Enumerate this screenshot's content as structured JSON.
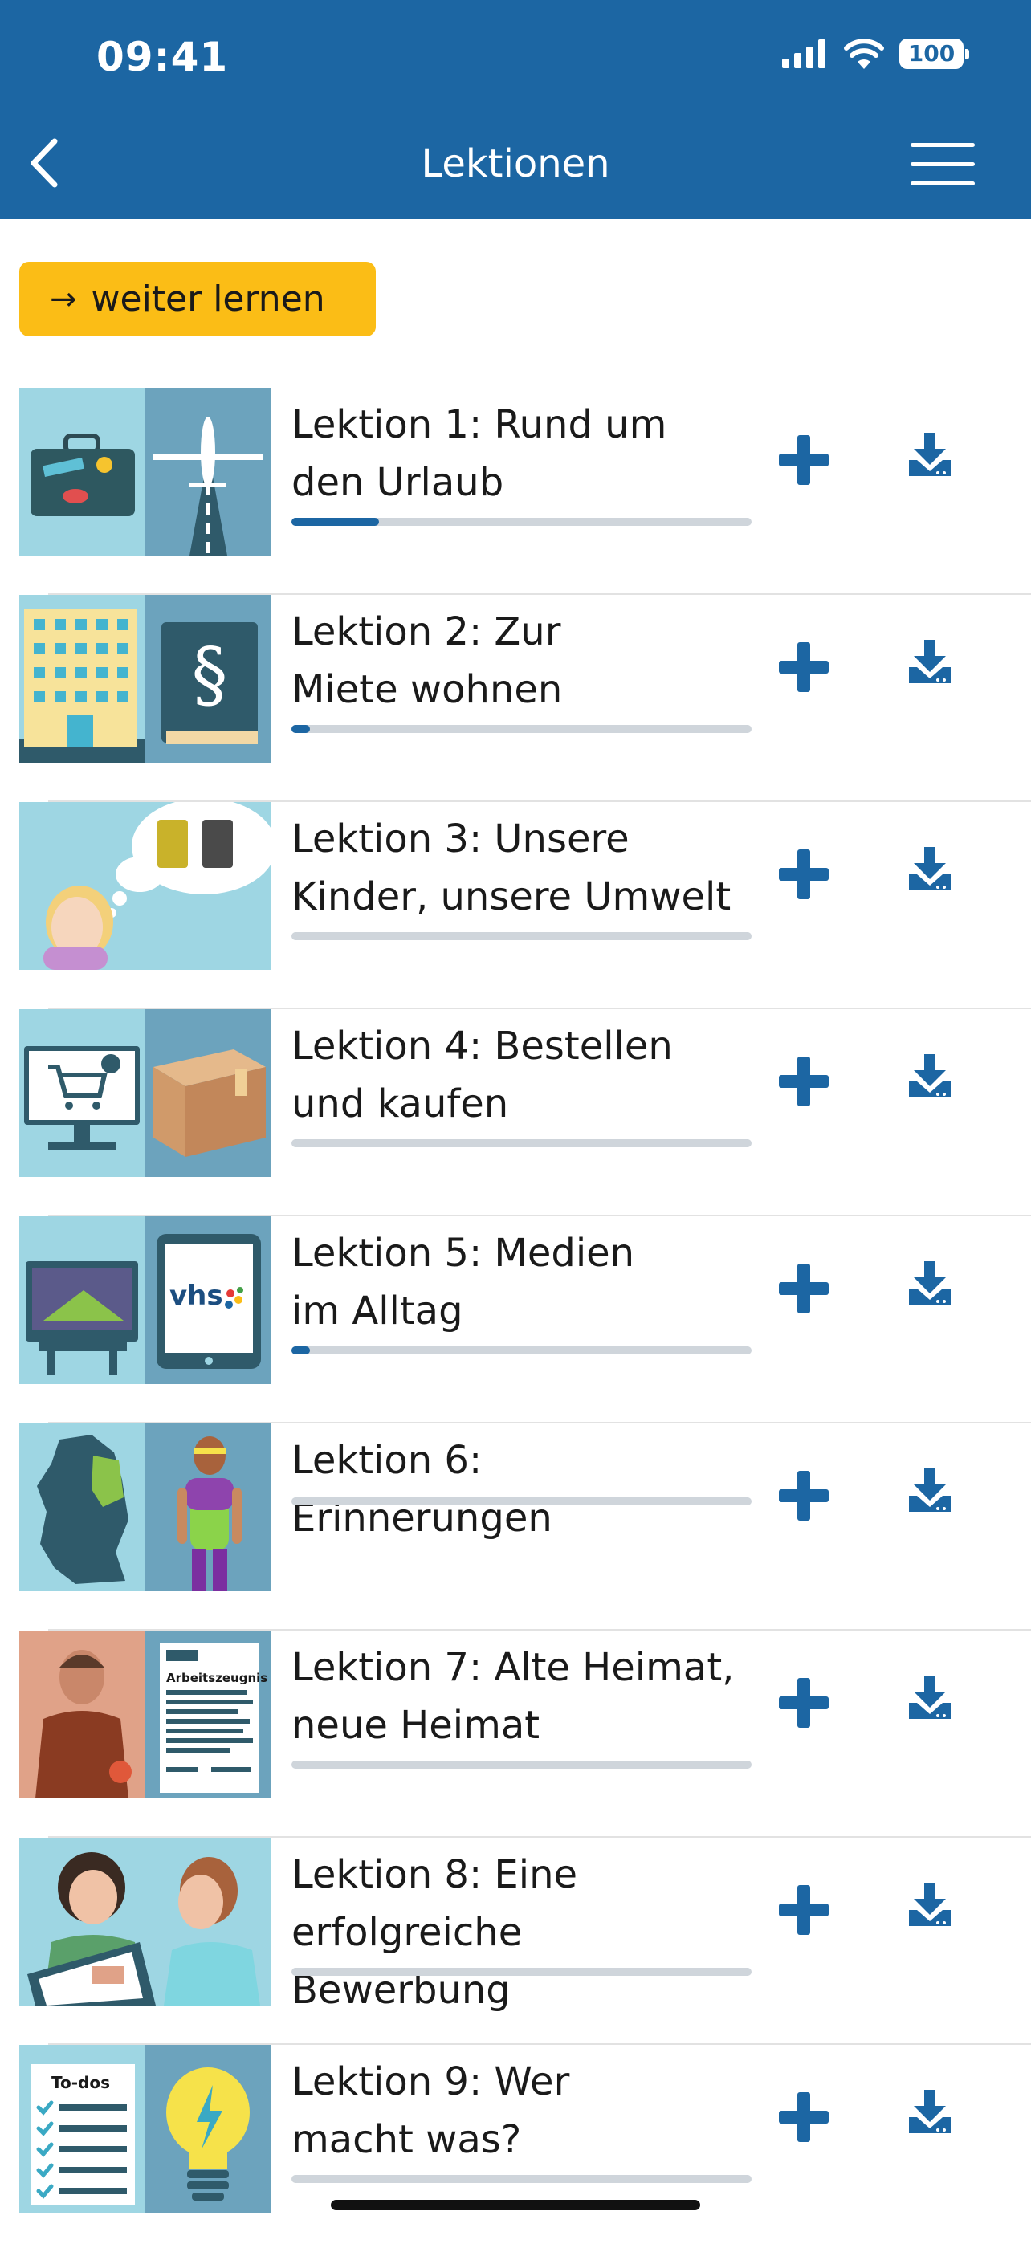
{
  "status_bar": {
    "time": "09:41",
    "battery": "100"
  },
  "header": {
    "title": "Lektionen"
  },
  "continue_button": {
    "label": "weiter lernen"
  },
  "lessons": [
    {
      "line1": "Lektion 1: Rund um",
      "line2": "den Urlaub",
      "progress": 0.19
    },
    {
      "line1": "Lektion 2: Zur",
      "line2": "Miete wohnen",
      "progress": 0.04
    },
    {
      "line1": "Lektion 3: Unsere",
      "line2": "Kinder, unsere Umwelt",
      "progress": 0.0
    },
    {
      "line1": "Lektion 4: Bestellen",
      "line2": "und kaufen",
      "progress": 0.0
    },
    {
      "line1": "Lektion 5: Medien",
      "line2": "im Alltag",
      "progress": 0.04
    },
    {
      "line1": "Lektion 6: Erinnerungen",
      "line2": "",
      "progress": 0.0
    },
    {
      "line1": "Lektion 7: Alte Heimat,",
      "line2": "neue Heimat",
      "progress": 0.0
    },
    {
      "line1": "Lektion 8: Eine",
      "line2": "erfolgreiche Bewerbung",
      "progress": 0.0
    },
    {
      "line1": "Lektion 9: Wer",
      "line2": "macht was?",
      "progress": 0.0
    }
  ],
  "thumbnail_labels": {
    "tablet_logo": "vhs",
    "document_heading": "Arbeitszeugnis",
    "todo_heading": "To-dos"
  },
  "colors": {
    "brand": "#1c66a3",
    "accent": "#fbbd16"
  }
}
